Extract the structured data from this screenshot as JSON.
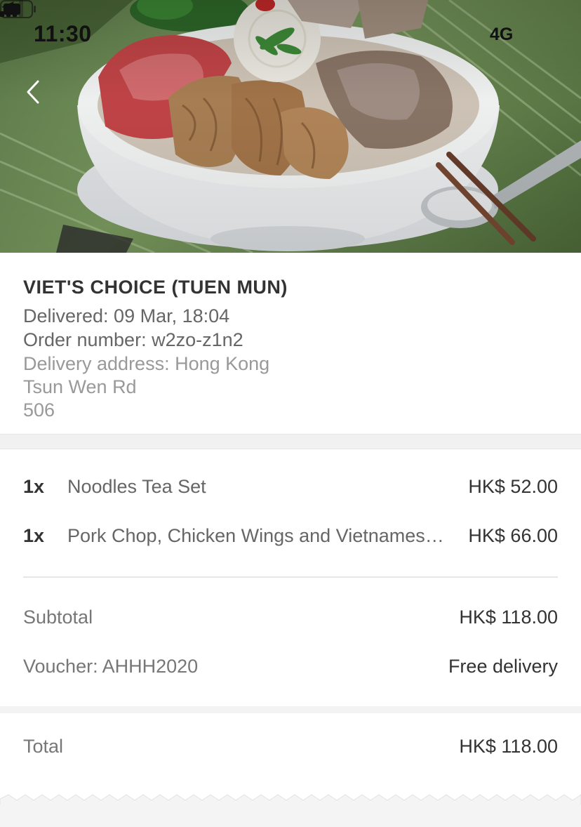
{
  "status_bar": {
    "time": "11:30",
    "network": "4G",
    "icons": [
      "location-arrow-icon",
      "signal-icon",
      "battery-icon"
    ]
  },
  "hero": {
    "image": "pho-noodle-bowl-photo"
  },
  "navigation": {
    "back_icon": "chevron-left-icon"
  },
  "restaurant": {
    "name": "VIET'S CHOICE (TUEN MUN)",
    "delivered": "Delivered: 09 Mar, 18:04",
    "order_number": "Order number: w2zo-z1n2",
    "address_line1": "Delivery address: Hong Kong",
    "address_line2": "Tsun Wen Rd",
    "address_line3": "506"
  },
  "items": [
    {
      "qty": "1x",
      "name": "Noodles Tea Set",
      "price": "HK$ 52.00"
    },
    {
      "qty": "1x",
      "name": "Pork Chop, Chicken Wings and Vietnamese Spring Rolls",
      "price": "HK$ 66.00"
    }
  ],
  "summary": {
    "subtotal_label": "Subtotal",
    "subtotal_value": "HK$ 118.00",
    "voucher_label": "Voucher: AHHH2020",
    "voucher_value": "Free delivery"
  },
  "total": {
    "label": "Total",
    "value": "HK$ 118.00"
  },
  "colors": {
    "heading": "#333333",
    "body_text": "#666666",
    "muted_text": "#999999",
    "divider": "#e6e6e6",
    "background": "#f4f4f4"
  }
}
